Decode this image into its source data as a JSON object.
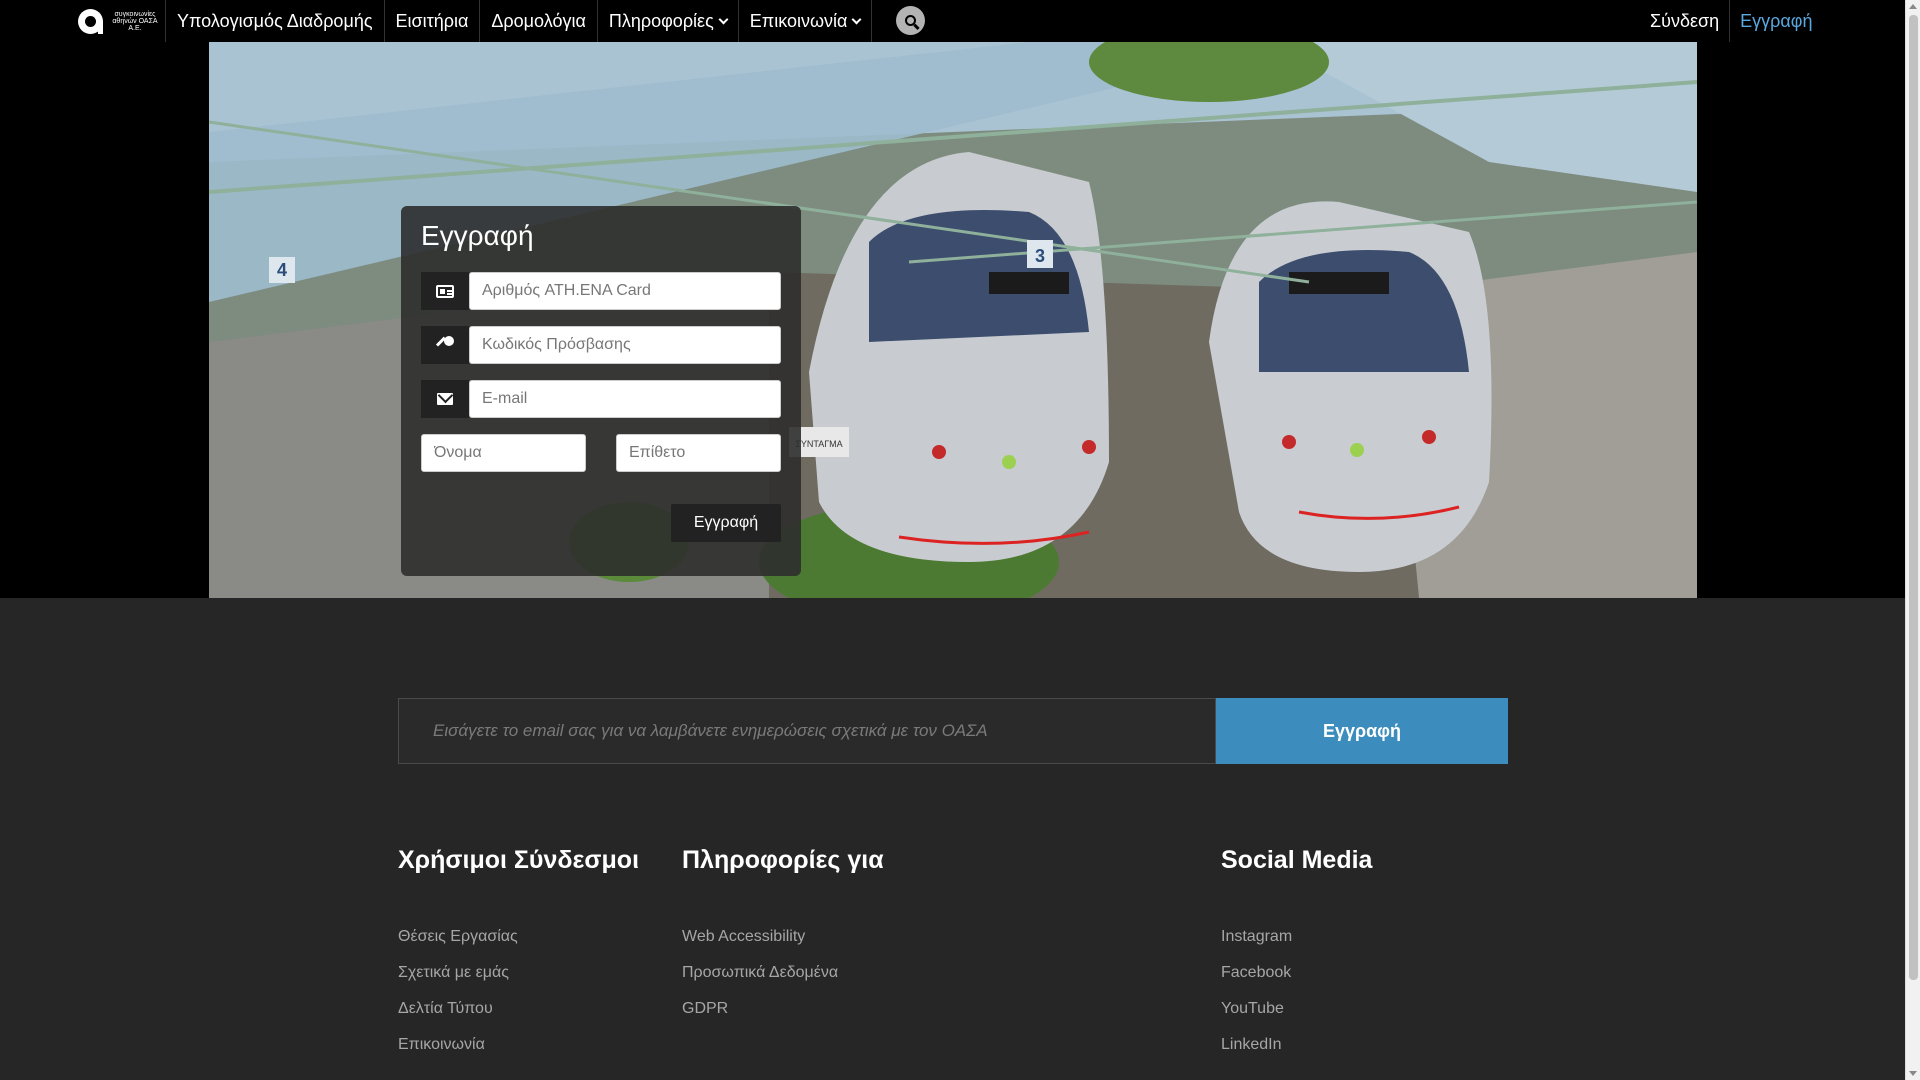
{
  "logo": {
    "text": "συγκοινωνίες αθηνών ΟΑΣΑ Α.Ε."
  },
  "nav": {
    "items": [
      {
        "label": "Υπολογισμός Διαδρομής",
        "dropdown": false
      },
      {
        "label": "Εισιτήρια",
        "dropdown": false
      },
      {
        "label": "Δρομολόγια",
        "dropdown": false
      },
      {
        "label": "Πληροφορίες",
        "dropdown": true
      },
      {
        "label": "Επικοινωνία",
        "dropdown": true
      }
    ],
    "search_icon": "search-icon",
    "login_label": "Σύνδεση",
    "register_label": "Εγγραφή",
    "register_color": "#5aa8e0"
  },
  "hero": {
    "platform_sign_left": "4",
    "platform_sign_right": "3",
    "station_sign": "ΣΥΝΤΑΓΜΑ"
  },
  "registration": {
    "title": "Εγγραφή",
    "card_placeholder": "Αριθμός ATH.ENA Card",
    "password_placeholder": "Κωδικός Πρόσβασης",
    "email_placeholder": "E-mail",
    "firstname_placeholder": "Όνομα",
    "lastname_placeholder": "Επίθετο",
    "submit_label": "Εγγραφή"
  },
  "newsletter": {
    "placeholder": "Εισάγετε το email σας για να λαμβάνετε ενημερώσεις σχετικά με τον ΟΑΣΑ",
    "button_label": "Εγγραφή",
    "button_color": "#3c8dbd"
  },
  "footer": {
    "useful_links": {
      "title": "Χρήσιμοι Σύνδεσμοι",
      "items": [
        "Θέσεις Εργασίας",
        "Σχετικά με εμάς",
        "Δελτία Τύπου",
        "Επικοινωνία"
      ]
    },
    "info": {
      "title": "Πληροφορίες για",
      "items": [
        "Web Accessibility",
        "Προσωπικά Δεδομένα",
        "GDPR"
      ]
    },
    "social": {
      "title": "Social Media",
      "items": [
        "Instagram",
        "Facebook",
        "YouTube",
        "LinkedIn"
      ]
    }
  }
}
